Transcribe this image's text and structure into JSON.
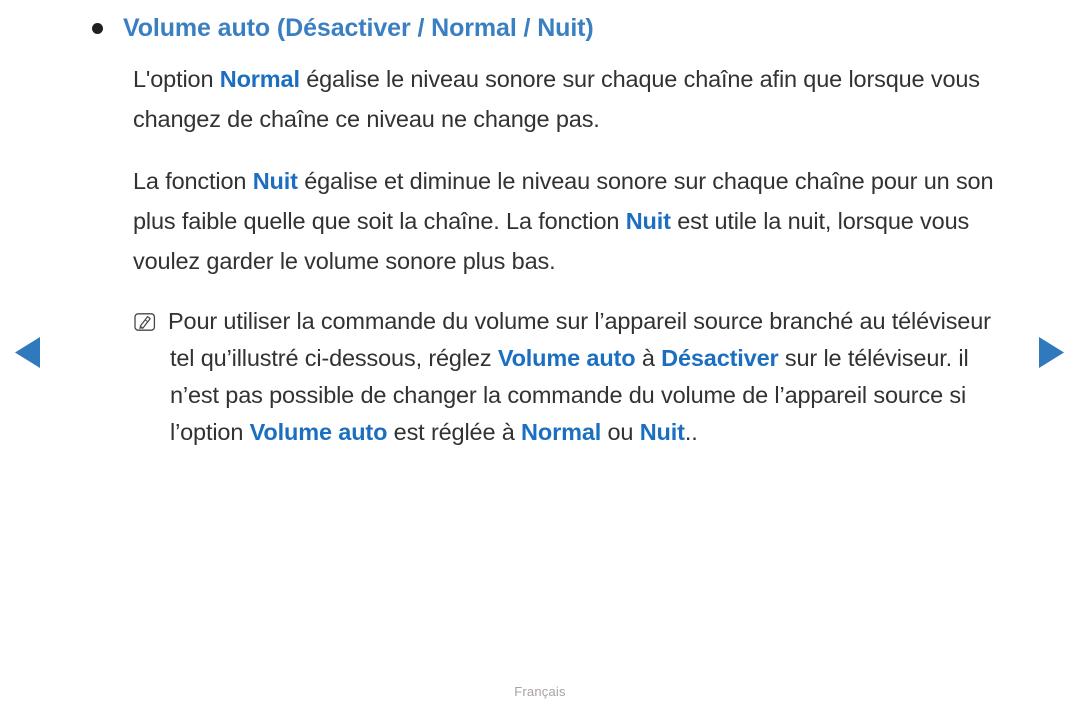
{
  "colors": {
    "accent_blue": "#3a7fc1",
    "highlight_blue": "#1c6fc0",
    "body_text": "#333132",
    "bullet": "#231f20",
    "footer_text": "#a9a1a4",
    "background": "#ffffff"
  },
  "heading": {
    "bullet": "•",
    "text": "Volume auto (Désactiver / Normal / Nuit)"
  },
  "paragraphs": [
    {
      "id": "paragraph-normal",
      "runs": [
        {
          "text": "L'option ",
          "style": "normal"
        },
        {
          "text": "Normal",
          "style": "highlight"
        },
        {
          "text": " égalise le niveau sonore sur chaque chaîne afin que lorsque vous changez de chaîne ce niveau ne change pas.",
          "style": "normal"
        }
      ]
    },
    {
      "id": "paragraph-nuit",
      "runs": [
        {
          "text": "La fonction ",
          "style": "normal"
        },
        {
          "text": "Nuit",
          "style": "highlight"
        },
        {
          "text": " égalise et diminue le niveau sonore sur chaque chaîne pour un son plus faible quelle que soit la chaîne. La fonction ",
          "style": "normal"
        },
        {
          "text": "Nuit",
          "style": "highlight"
        },
        {
          "text": " est utile la nuit, lorsque vous voulez garder le volume sonore plus bas.",
          "style": "normal"
        }
      ]
    }
  ],
  "note": {
    "id": "note-block",
    "icon": "note-pencil-icon",
    "runs": [
      {
        "text": "Pour utiliser la commande du volume sur l’appareil source branché au téléviseur tel qu’illustré ci-dessous, réglez ",
        "style": "normal"
      },
      {
        "text": "Volume auto",
        "style": "highlight"
      },
      {
        "text": " à ",
        "style": "normal"
      },
      {
        "text": "Désactiver",
        "style": "highlight"
      },
      {
        "text": " sur le téléviseur. il n’est pas possible de changer la commande du volume de l’appareil source si l’option ",
        "style": "normal"
      },
      {
        "text": "Volume auto",
        "style": "highlight"
      },
      {
        "text": " est réglée à ",
        "style": "normal"
      },
      {
        "text": "Normal",
        "style": "highlight"
      },
      {
        "text": " ou ",
        "style": "normal"
      },
      {
        "text": "Nuit",
        "style": "highlight"
      },
      {
        "text": "..",
        "style": "normal"
      }
    ]
  },
  "navigation": {
    "prev": {
      "icon": "triangle-left-icon",
      "label": "◀"
    },
    "next": {
      "icon": "triangle-right-icon",
      "label": "▶"
    }
  },
  "footer": {
    "language": "Français"
  }
}
